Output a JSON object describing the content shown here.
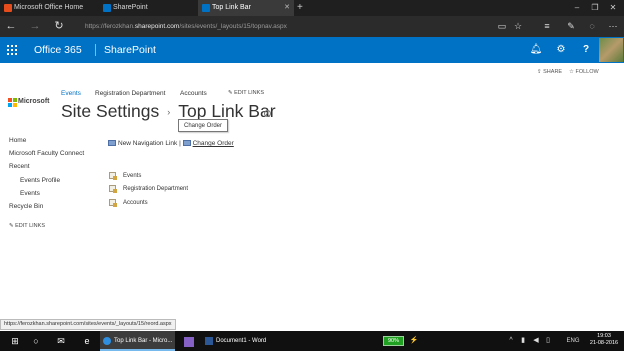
{
  "browser": {
    "tabs": [
      {
        "label": "Microsoft Office Home",
        "favicon_color": "#e74c1c"
      },
      {
        "label": "SharePoint",
        "favicon_color": "#0072c6"
      },
      {
        "label": "Top Link Bar",
        "favicon_color": "#0072c6"
      }
    ],
    "new_tab": "+",
    "url_prefix": "https://ferozkhan.",
    "url_domain": "sharepoint.com",
    "url_suffix": "/sites/events/_layouts/15/topnav.aspx"
  },
  "suite_bar": {
    "title": "Office 365",
    "app": "SharePoint",
    "color": "#0072c6"
  },
  "page_actions": {
    "share": "SHARE",
    "follow": "FOLLOW"
  },
  "site": {
    "logo_text": "Microsoft",
    "top_nav": [
      "Events",
      "Registration Department",
      "Accounts"
    ],
    "edit_links": "EDIT LINKS",
    "breadcrumb_parent": "Site Settings",
    "breadcrumb_separator": "›",
    "page_title": "Top Link Bar",
    "tooltip": "Change Order"
  },
  "left_nav": {
    "items": [
      {
        "label": "Home"
      },
      {
        "label": "Microsoft Faculty Connect"
      },
      {
        "label": "Recent"
      },
      {
        "label": "Events Profile"
      },
      {
        "label": "Events"
      },
      {
        "label": "Recycle Bin"
      }
    ],
    "edit_links": "EDIT LINKS"
  },
  "content": {
    "new_link": "New Navigation Link",
    "separator": "|",
    "change_order": "Change Order",
    "links": [
      "Events",
      "Registration Department",
      "Accounts"
    ]
  },
  "status_url": "https://ferozkhan.sharepoint.com/sites/events/_layouts/15/reord.aspx",
  "taskbar": {
    "apps": [
      {
        "label": "Top Link Bar - Micro..."
      },
      {
        "label": "Document1 - Word"
      }
    ],
    "battery": "90%",
    "language": "ENG",
    "time": "19:03",
    "date": "21-08-2016"
  }
}
